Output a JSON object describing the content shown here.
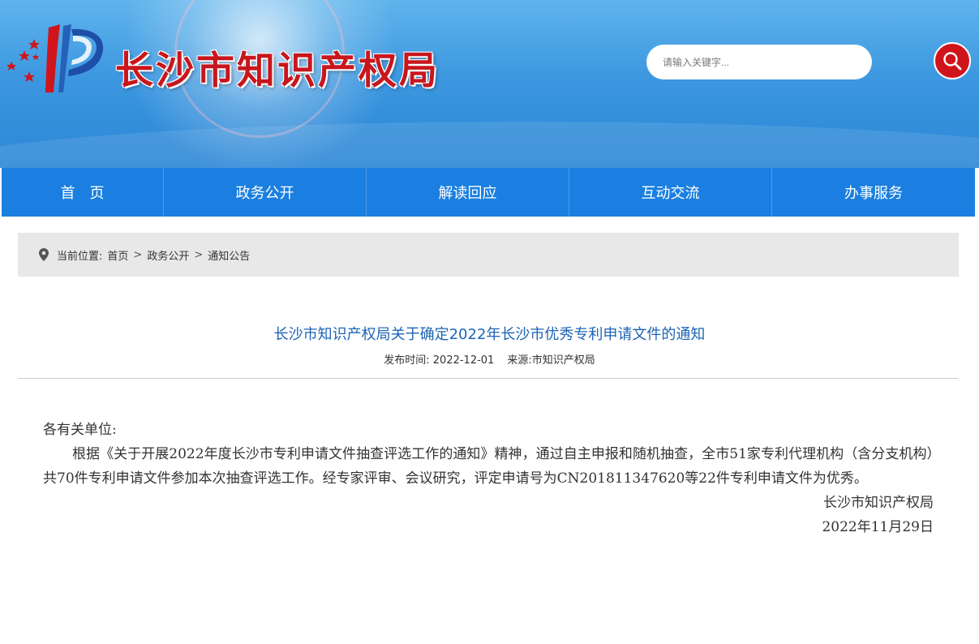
{
  "header": {
    "site_title": "长沙市知识产权局",
    "search_placeholder": "请输入关键字...",
    "colors": {
      "banner": "#3d98e0",
      "title": "#c8161d",
      "search_button": "#d0141c"
    }
  },
  "nav": {
    "items": [
      {
        "label": "首页"
      },
      {
        "label": "政务公开"
      },
      {
        "label": "解读回应"
      },
      {
        "label": "互动交流"
      },
      {
        "label": "办事服务"
      }
    ],
    "color": "#1a7fe0"
  },
  "breadcrumb": {
    "prefix": "当前位置:",
    "items": [
      "首页",
      "政务公开",
      "通知公告"
    ],
    "separator": ">"
  },
  "article": {
    "title": "长沙市知识产权局关于确定2022年长沙市优秀专利申请文件的通知",
    "publish_label": "发布时间: 2022-12-01",
    "source_label": "来源:市知识产权局",
    "salutation": "各有关单位:",
    "paragraph": "根据《关于开展2022年度长沙市专利申请文件抽查评选工作的通知》精神，通过自主申报和随机抽查，全市51家专利代理机构（含分支机构）共70件专利申请文件参加本次抽查评选工作。经专家评审、会议研究，评定申请号为CN201811347620等22件专利申请文件为优秀。",
    "signature": "长沙市知识产权局",
    "date": "2022年11月29日",
    "title_color": "#1c64b5"
  }
}
